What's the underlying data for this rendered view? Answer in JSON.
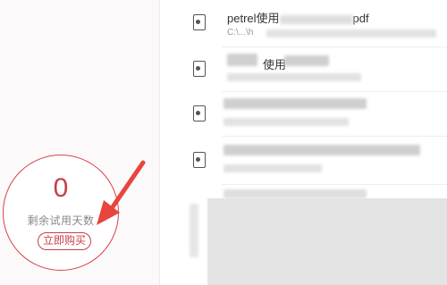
{
  "trial": {
    "remaining_days": "0",
    "label": "剩余试用天数",
    "buy_button": "立即购买"
  },
  "files": [
    {
      "name": "petrel使用",
      "ext": "pdf",
      "path": "C:\\...\\h"
    },
    {
      "name": "使用",
      "path": ""
    },
    {
      "name": "",
      "path": ""
    },
    {
      "name": "",
      "path": ""
    }
  ],
  "colors": {
    "accent": "#c83f47",
    "sidebar_bg": "#fbf9fa",
    "arrow": "#e8453c"
  }
}
